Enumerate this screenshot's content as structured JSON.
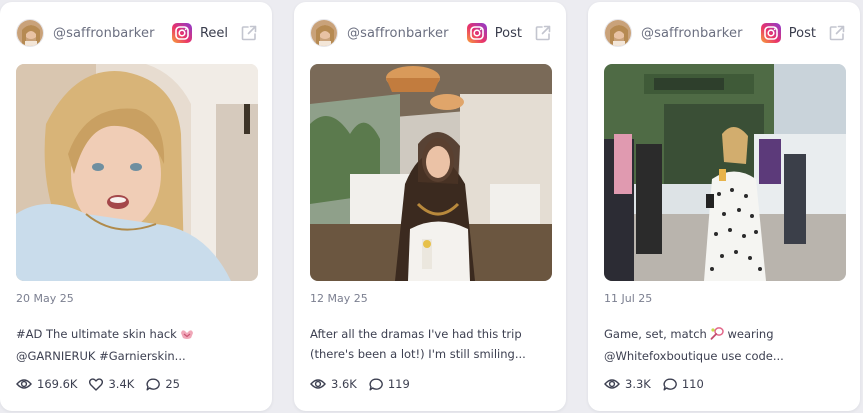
{
  "cards": [
    {
      "handle": "@saffronbarker",
      "type": "Reel",
      "date": "20 May 25",
      "caption_line1": "#AD The ultimate skin hack",
      "caption_line2": "@GARNIERUK #Garnierskin...",
      "caption_emoji": "pink-heart-hands-icon",
      "stats": {
        "views": "169.6K",
        "likes": "3.4K",
        "comments": "25"
      }
    },
    {
      "handle": "@saffronbarker",
      "type": "Post",
      "date": "12 May 25",
      "caption_line1": "After all the dramas I've had this trip",
      "caption_line2": "(there's been a lot!) I'm still smiling...",
      "stats": {
        "views": "3.6K",
        "comments": "119"
      }
    },
    {
      "handle": "@saffronbarker",
      "type": "Post",
      "date": "11 Jul 25",
      "caption_line1": "Game, set, match",
      "caption_line2": "@Whitefoxboutique use code...",
      "caption_emoji": "tennis-racket-icon",
      "stats": {
        "views": "3.3K",
        "comments": "110"
      }
    }
  ],
  "colors": {
    "background": "#ececf1",
    "card": "#ffffff",
    "text": "#3d4051",
    "muted": "#7b7f90"
  }
}
